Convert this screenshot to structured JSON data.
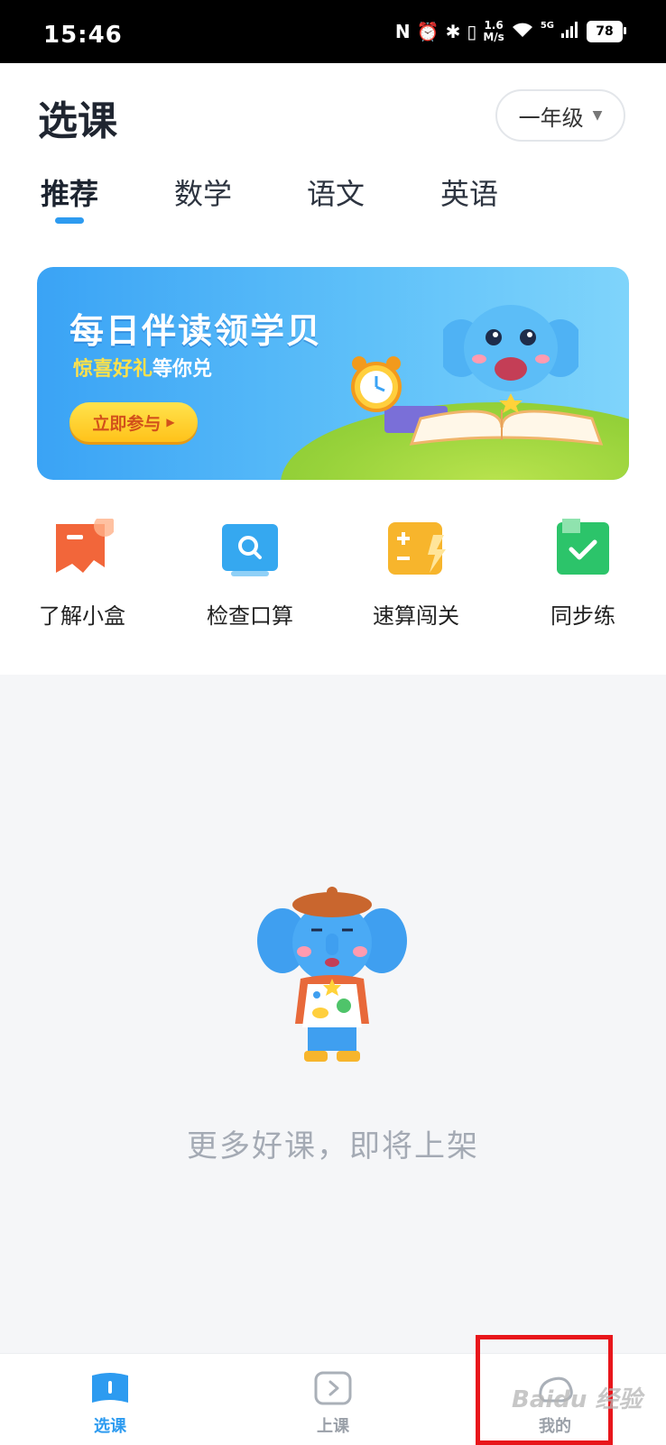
{
  "status_bar": {
    "time": "15:46",
    "speed_value": "1.6",
    "speed_unit": "M/s",
    "network": "5G",
    "battery": "78"
  },
  "header": {
    "title": "选课",
    "grade_selector": "一年级"
  },
  "tabs": [
    {
      "label": "推荐",
      "active": true
    },
    {
      "label": "数学",
      "active": false
    },
    {
      "label": "语文",
      "active": false
    },
    {
      "label": "英语",
      "active": false
    }
  ],
  "banner": {
    "title": "每日伴读领学贝",
    "subtitle_highlight": "惊喜好礼",
    "subtitle_rest": "等你兑",
    "cta": "立即参与"
  },
  "quick_actions": [
    {
      "label": "了解小盒",
      "icon": "flag-icon",
      "color": "#f2663a"
    },
    {
      "label": "检查口算",
      "icon": "search-doc-icon",
      "color": "#35a8f0"
    },
    {
      "label": "速算闯关",
      "icon": "calculator-icon",
      "color": "#f7b52c"
    },
    {
      "label": "同步练",
      "icon": "check-book-icon",
      "color": "#2cc46a"
    }
  ],
  "empty_state": {
    "message": "更多好课，即将上架"
  },
  "bottom_nav": [
    {
      "label": "选课",
      "icon": "book-icon",
      "active": true
    },
    {
      "label": "上课",
      "icon": "play-icon",
      "active": false
    },
    {
      "label": "我的",
      "icon": "profile-icon",
      "active": false
    }
  ],
  "watermark": "Baidu 经验",
  "colors": {
    "accent": "#2d9bf0",
    "highlight_box": "#e8161b"
  }
}
